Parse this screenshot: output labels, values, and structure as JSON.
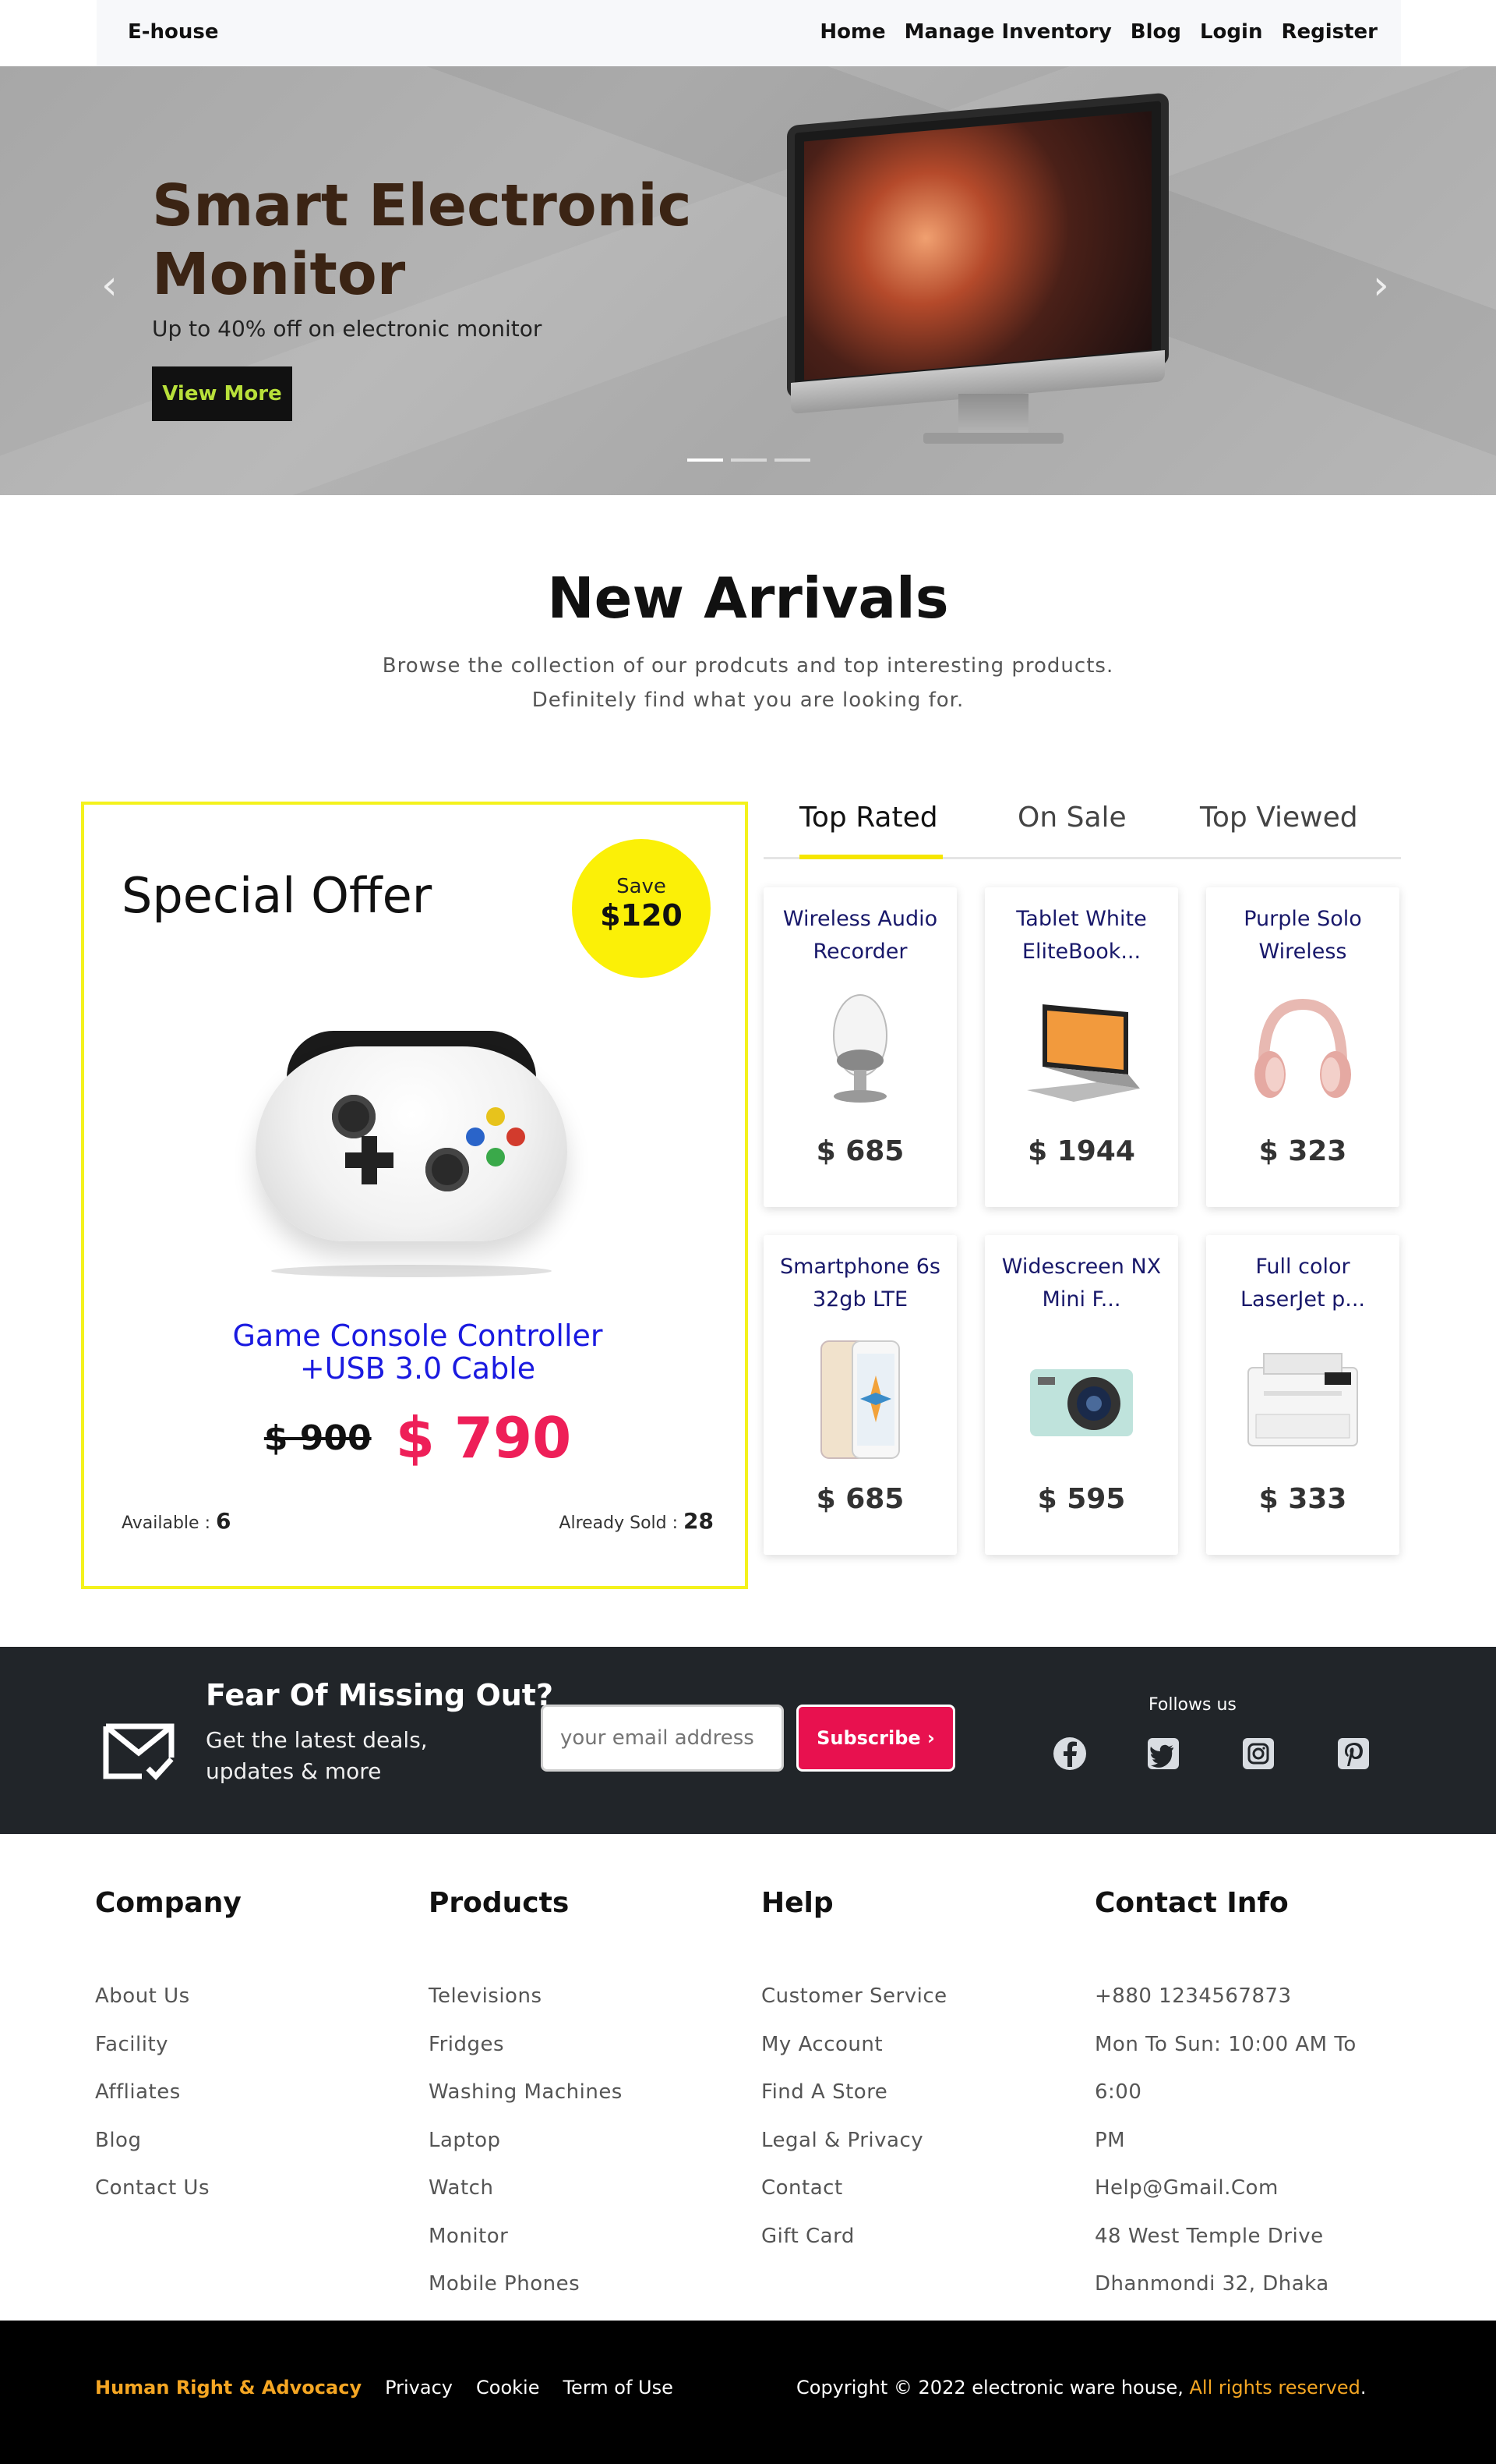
{
  "nav": {
    "brand": "E-house",
    "links": [
      "Home",
      "Manage Inventory",
      "Blog",
      "Login",
      "Register"
    ]
  },
  "hero": {
    "title": "Smart Electronic Monitor",
    "subtitle": "Up to 40% off on electronic monitor",
    "button": "View More",
    "prev_arrow": "‹",
    "next_arrow": "›",
    "slides": 3,
    "active_slide": 1
  },
  "new_arrivals": {
    "title": "New Arrivals",
    "desc_line1": "Browse the collection of our prodcuts and top interesting products.",
    "desc_line2": "Definitely find what you are looking for."
  },
  "special_offer": {
    "title": "Special Offer",
    "save_label": "Save",
    "save_value": "$120",
    "product_line1": "Game Console Controller",
    "product_line2": "+USB 3.0 Cable",
    "old_price": "$ 900",
    "new_price": "$ 790",
    "available_label": "Available :",
    "available_value": "6",
    "sold_label": "Already Sold :",
    "sold_value": "28"
  },
  "tabs": {
    "items": [
      "Top Rated",
      "On Sale",
      "Top Viewed"
    ],
    "active": "Top Rated"
  },
  "products": [
    {
      "line1": "Wireless Audio",
      "line2": "Recorder",
      "price": "$ 685",
      "icon": "speaker-image"
    },
    {
      "line1": "Tablet White",
      "line2": "EliteBook...",
      "price": "$ 1944",
      "icon": "laptop-image"
    },
    {
      "line1": "Purple Solo",
      "line2": "Wireless",
      "price": "$ 323",
      "icon": "headphones-image"
    },
    {
      "line1": "Smartphone 6s",
      "line2": "32gb LTE",
      "price": "$ 685",
      "icon": "phone-image"
    },
    {
      "line1": "Widescreen NX",
      "line2": "Mini F...",
      "price": "$ 595",
      "icon": "camera-image"
    },
    {
      "line1": "Full color",
      "line2": "LaserJet p...",
      "price": "$ 333",
      "icon": "printer-image"
    }
  ],
  "newsletter": {
    "title": "Fear Of Missing Out?",
    "sub_line1": "Get the latest deals,",
    "sub_line2": "updates & more",
    "placeholder": "your email address",
    "button": "Subscribe ›",
    "follow_label": "Follows us",
    "socials": [
      "facebook-icon",
      "twitter-icon",
      "instagram-icon",
      "pinterest-icon"
    ]
  },
  "footer": {
    "company": {
      "title": "Company",
      "items": [
        "About Us",
        "Facility",
        "Affliates",
        "Blog",
        "Contact Us"
      ]
    },
    "products": {
      "title": "Products",
      "items": [
        "Televisions",
        "Fridges",
        "Washing Machines",
        "Laptop",
        "Watch",
        "Monitor",
        "Mobile Phones"
      ]
    },
    "help": {
      "title": "Help",
      "items": [
        "Customer Service",
        "My Account",
        "Find A Store",
        "Legal & Privacy",
        "Contact",
        "Gift Card"
      ]
    },
    "contact": {
      "title": "Contact Info",
      "items": [
        "+880 1234567873",
        "Mon To Sun: 10:00 AM To 6:00",
        "PM",
        "Help@Gmail.Com",
        "48 West Temple Drive",
        "Dhanmondi 32, Dhaka"
      ]
    }
  },
  "bottom": {
    "highlight_link": "Human Right & Advocacy",
    "links": [
      "Privacy",
      "Cookie",
      "Term of Use"
    ],
    "copyright": "Copyright © 2022 electronic ware house,",
    "rights": "All rights reserved",
    "period": "."
  },
  "colors": {
    "accent_yellow": "#f6e600",
    "price_red": "#ee1f58",
    "subscribe_red": "#e8114f",
    "footer_highlight": "#f5a623",
    "dark": "#212529"
  }
}
